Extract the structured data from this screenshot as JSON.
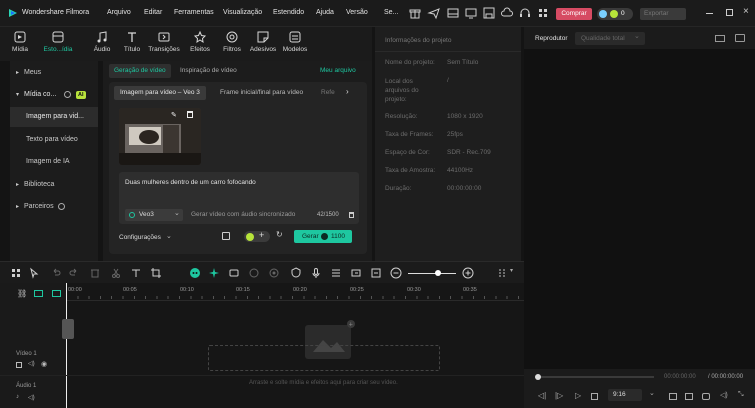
{
  "app": {
    "title": "Wondershare Filmora"
  },
  "menu": [
    "Arquivo",
    "Editar",
    "Ferramentas",
    "Visualização",
    "Estendido",
    "Ajuda",
    "Versão",
    "Se..."
  ],
  "titlebar": {
    "buy_label": "Comprar",
    "credits": "0",
    "export_label": "Exportar"
  },
  "toolbar": [
    {
      "label": "Mídia",
      "icon": "media-icon"
    },
    {
      "label": "Esto...ídia",
      "icon": "stock-media-icon"
    },
    {
      "label": "Áudio",
      "icon": "audio-icon"
    },
    {
      "label": "Título",
      "icon": "title-icon"
    },
    {
      "label": "Transições",
      "icon": "transitions-icon"
    },
    {
      "label": "Efeitos",
      "icon": "effects-icon"
    },
    {
      "label": "Filtros",
      "icon": "filters-icon"
    },
    {
      "label": "Adesivos",
      "icon": "stickers-icon"
    },
    {
      "label": "Modelos",
      "icon": "templates-icon"
    }
  ],
  "leftnav": {
    "items": [
      {
        "label": "Meus",
        "caret": "▸"
      },
      {
        "label": "Mídia co...",
        "caret": "▾",
        "badge": "AI"
      },
      {
        "label": "Imagem para vid...",
        "active": true
      },
      {
        "label": "Texto para vídeo"
      },
      {
        "label": "Imagem de IA"
      },
      {
        "label": "Biblioteca",
        "caret": "▸"
      },
      {
        "label": "Parceiros",
        "caret": "▸"
      }
    ]
  },
  "mid": {
    "tabs": [
      "Geração de vídeo",
      "Inspiração de vídeo"
    ],
    "my_file": "Meu arquivo",
    "subtabs": [
      "Imagem para vídeo – Veo 3",
      "Frame inicial/final para vídeo",
      "Refe"
    ],
    "prompt": "Duas mulheres dentro de um carro fofocando",
    "model": "Veo3",
    "sync_audio": "Gerar vídeo com áudio sincronizado",
    "counter": "42/1500",
    "settings": "Configurações",
    "generate_label": "Gerar",
    "generate_cost": "1100"
  },
  "info": {
    "title": "Informações do projeto",
    "rows": [
      {
        "k": "Nome do projeto:",
        "v": "Sem Título"
      },
      {
        "k": "Local dos arquivos do projeto:",
        "v": "/"
      },
      {
        "k": "Resolução:",
        "v": "1080 x 1920"
      },
      {
        "k": "Taxa de Frames:",
        "v": "25fps"
      },
      {
        "k": "Espaço de Cor:",
        "v": "SDR - Rec.709"
      },
      {
        "k": "Taxa de Amostra:",
        "v": "44100Hz"
      },
      {
        "k": "Duração:",
        "v": "00:00:00:00"
      }
    ]
  },
  "player": {
    "tab": "Reprodutor",
    "quality": "Qualidade total",
    "time_current": "00:00:00:00",
    "time_total": "/ 00:00:00:00",
    "ratio": "9:16"
  },
  "timeline": {
    "ticks": [
      "00:00",
      "00:05",
      "00:10",
      "00:15",
      "00:20",
      "00:25",
      "00:30",
      "00:35"
    ],
    "video_track": "Vídeo 1",
    "audio_track": "Áudio 1",
    "drop_hint": "Arraste e solte mídia e efeitos aqui para criar seu vídeo."
  },
  "colors": {
    "accent": "#1ec7a0",
    "buy": "#e0506a"
  }
}
